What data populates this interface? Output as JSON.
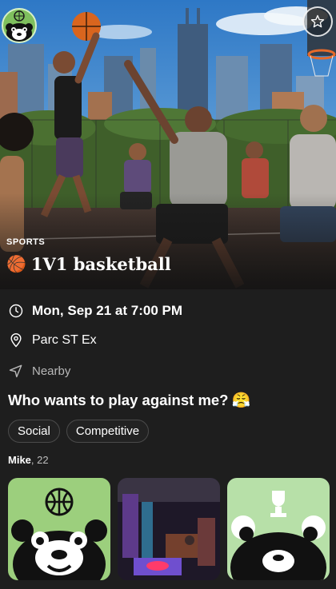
{
  "event": {
    "category": "SPORTS",
    "title_emoji": "🏀",
    "title": "1V1 basketball",
    "datetime": "Mon, Sep 21 at 7:00 PM",
    "location": "Parc ST Ex",
    "distance": "Nearby",
    "question": "Who wants to play against me?",
    "question_emoji": "😤",
    "tags": [
      "Social",
      "Competitive"
    ]
  },
  "host": {
    "name": "Mike",
    "age": ", 22"
  },
  "icons": {
    "avatar": "panda-avatar-icon",
    "favorite": "star-icon",
    "datetime": "clock-icon",
    "location": "map-pin-icon",
    "distance": "navigation-arrow-icon"
  },
  "colors": {
    "background": "#1e1e1e",
    "avatar_bg": "#7fbf5e",
    "photo_green": "#9ccf7d",
    "photo_mint": "#b7e0a8"
  }
}
